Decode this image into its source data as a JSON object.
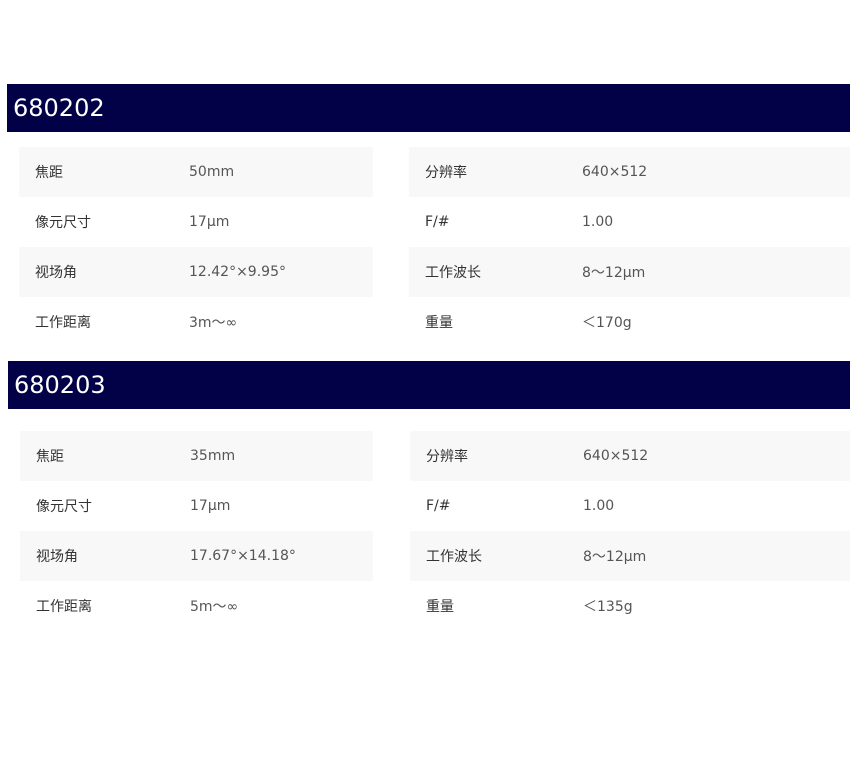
{
  "products": [
    {
      "model": "680202",
      "left_specs": [
        {
          "label": "焦距",
          "value": "50mm"
        },
        {
          "label": "像元尺寸",
          "value": "17μm"
        },
        {
          "label": "视场角",
          "value": "12.42°×9.95°"
        },
        {
          "label": "工作距离",
          "value": "3m～∞"
        }
      ],
      "right_specs": [
        {
          "label": "分辨率",
          "value": "640×512"
        },
        {
          "label": "F/#",
          "value": "1.00"
        },
        {
          "label": "工作波长",
          "value": "8～12μm"
        },
        {
          "label": "重量",
          "value": "＜170g"
        }
      ]
    },
    {
      "model": "680203",
      "left_specs": [
        {
          "label": "焦距",
          "value": "35mm"
        },
        {
          "label": "像元尺寸",
          "value": "17μm"
        },
        {
          "label": "视场角",
          "value": "17.67°×14.18°"
        },
        {
          "label": "工作距离",
          "value": "5m～∞"
        }
      ],
      "right_specs": [
        {
          "label": "分辨率",
          "value": "640×512"
        },
        {
          "label": "F/#",
          "value": "1.00"
        },
        {
          "label": "工作波长",
          "value": "8～12μm"
        },
        {
          "label": "重量",
          "value": "＜135g"
        }
      ]
    }
  ],
  "colors": {
    "header_bg": "#020147",
    "header_text": "#ffffff",
    "row_shade": "#f8f8f8"
  }
}
